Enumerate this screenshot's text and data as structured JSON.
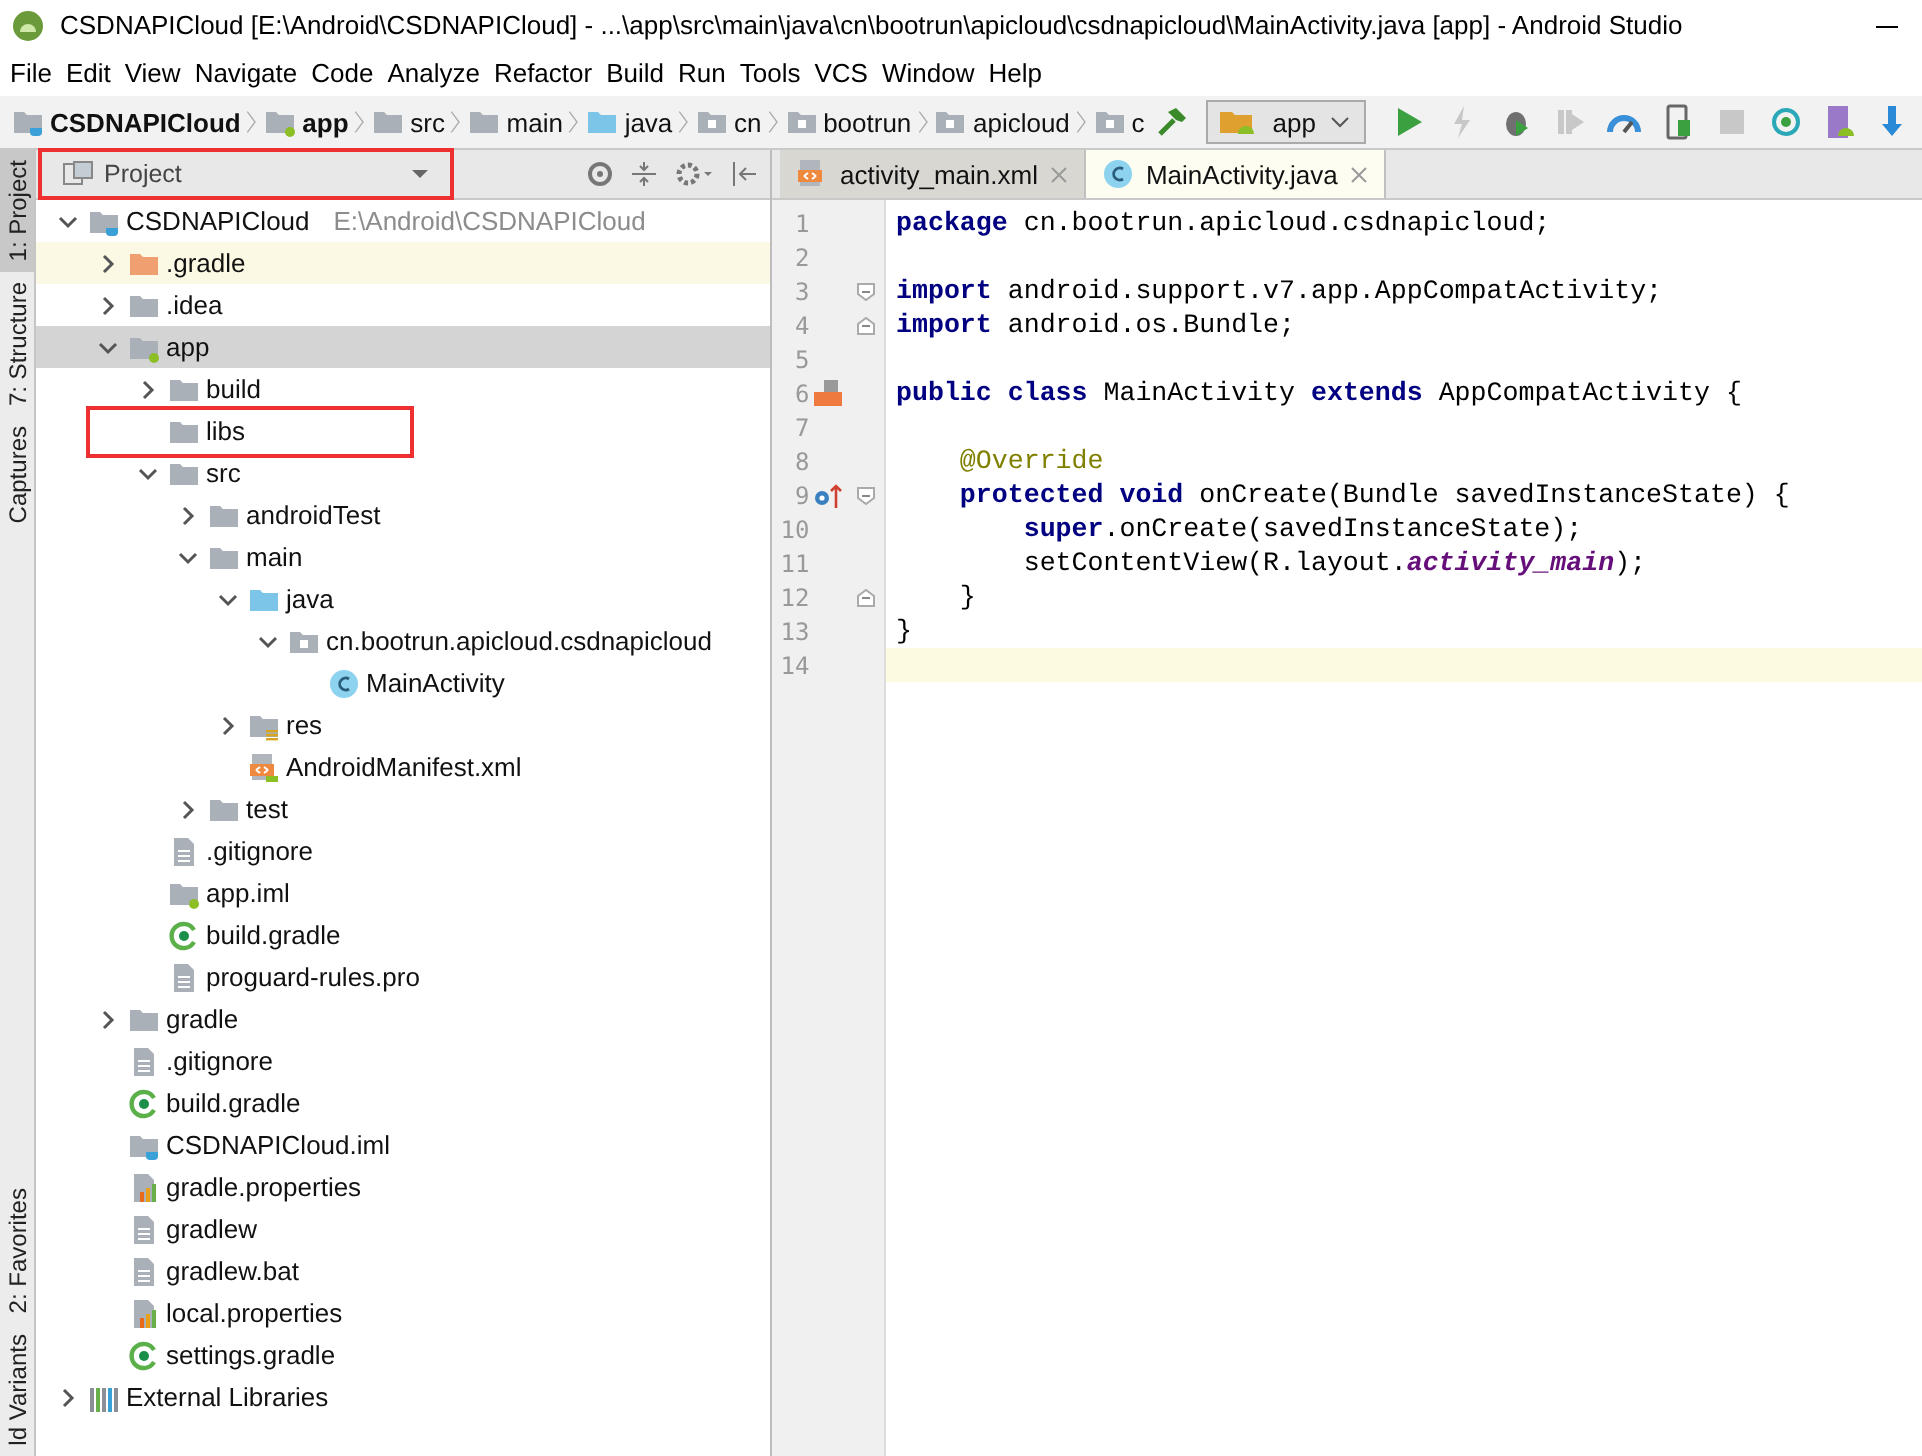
{
  "window": {
    "title": "CSDNAPICloud [E:\\Android\\CSDNAPICloud] - ...\\app\\src\\main\\java\\cn\\bootrun\\apicloud\\csdnapicloud\\MainActivity.java [app] - Android Studio"
  },
  "menu": [
    "File",
    "Edit",
    "View",
    "Navigate",
    "Code",
    "Analyze",
    "Refactor",
    "Build",
    "Run",
    "Tools",
    "VCS",
    "Window",
    "Help"
  ],
  "breadcrumbs": [
    {
      "label": "CSDNAPICloud",
      "kind": "project"
    },
    {
      "label": "app",
      "kind": "module"
    },
    {
      "label": "src",
      "kind": "folder"
    },
    {
      "label": "main",
      "kind": "folder"
    },
    {
      "label": "java",
      "kind": "source"
    },
    {
      "label": "cn",
      "kind": "package"
    },
    {
      "label": "bootrun",
      "kind": "package"
    },
    {
      "label": "apicloud",
      "kind": "package"
    },
    {
      "label": "c",
      "kind": "package"
    }
  ],
  "run_config": {
    "label": "app"
  },
  "tool_tabs_top": [
    {
      "label": "1: Project",
      "selected": true
    },
    {
      "label": "7: Structure",
      "selected": false
    },
    {
      "label": "Captures",
      "selected": false
    }
  ],
  "tool_tabs_bottom": [
    {
      "label": "2: Favorites",
      "selected": false
    },
    {
      "label": "ld Variants",
      "selected": false
    }
  ],
  "project_panel": {
    "view": "Project",
    "highlighted": true
  },
  "tree": [
    {
      "label": "CSDNAPICloud",
      "path": "E:\\Android\\CSDNAPICloud",
      "kind": "project",
      "expanded": true,
      "selected": false,
      "children": [
        {
          "label": ".gradle",
          "kind": "excluded",
          "expanded": false,
          "selected": false,
          "excluded": true
        },
        {
          "label": ".idea",
          "kind": "folder",
          "expanded": false,
          "selected": false
        },
        {
          "label": "app",
          "kind": "module",
          "expanded": true,
          "selected": true,
          "children": [
            {
              "label": "build",
              "kind": "folder",
              "expanded": false,
              "selected": false
            },
            {
              "label": "libs",
              "kind": "folder",
              "selected": false,
              "highlighted": true
            },
            {
              "label": "src",
              "kind": "folder",
              "expanded": true,
              "selected": false,
              "children": [
                {
                  "label": "androidTest",
                  "kind": "folder",
                  "expanded": false,
                  "selected": false
                },
                {
                  "label": "main",
                  "kind": "folder",
                  "expanded": true,
                  "selected": false,
                  "children": [
                    {
                      "label": "java",
                      "kind": "source",
                      "expanded": true,
                      "selected": false,
                      "children": [
                        {
                          "label": "cn.bootrun.apicloud.csdnapicloud",
                          "kind": "package",
                          "expanded": true,
                          "selected": false,
                          "children": [
                            {
                              "label": "MainActivity",
                              "kind": "class",
                              "selected": false
                            }
                          ]
                        }
                      ]
                    },
                    {
                      "label": "res",
                      "kind": "res",
                      "expanded": false,
                      "selected": false
                    },
                    {
                      "label": "AndroidManifest.xml",
                      "kind": "manifest",
                      "selected": false
                    }
                  ]
                },
                {
                  "label": "test",
                  "kind": "folder",
                  "expanded": false,
                  "selected": false
                }
              ]
            },
            {
              "label": ".gitignore",
              "kind": "text",
              "selected": false
            },
            {
              "label": "app.iml",
              "kind": "iml",
              "selected": false
            },
            {
              "label": "build.gradle",
              "kind": "gradle",
              "selected": false
            },
            {
              "label": "proguard-rules.pro",
              "kind": "text",
              "selected": false
            }
          ]
        },
        {
          "label": "gradle",
          "kind": "folder",
          "expanded": false,
          "selected": false
        },
        {
          "label": ".gitignore",
          "kind": "text",
          "selected": false
        },
        {
          "label": "build.gradle",
          "kind": "gradle",
          "selected": false
        },
        {
          "label": "CSDNAPICloud.iml",
          "kind": "project",
          "selected": false
        },
        {
          "label": "gradle.properties",
          "kind": "properties",
          "selected": false
        },
        {
          "label": "gradlew",
          "kind": "text",
          "selected": false
        },
        {
          "label": "gradlew.bat",
          "kind": "text",
          "selected": false
        },
        {
          "label": "local.properties",
          "kind": "properties",
          "selected": false
        },
        {
          "label": "settings.gradle",
          "kind": "gradle",
          "selected": false
        }
      ]
    },
    {
      "label": "External Libraries",
      "kind": "libraries",
      "expanded": false,
      "selected": false
    }
  ],
  "editor_tabs": [
    {
      "label": "activity_main.xml",
      "kind": "layout",
      "selected": false
    },
    {
      "label": "MainActivity.java",
      "kind": "class",
      "selected": true
    }
  ],
  "code": [
    {
      "number": "1",
      "current": false,
      "tokens": [
        {
          "kind": "keyword",
          "text": "package"
        },
        {
          "kind": "plain",
          "text": " cn.bootrun.apicloud.csdnapicloud;"
        }
      ]
    },
    {
      "number": "2",
      "current": false
    },
    {
      "number": "3",
      "current": false,
      "gutter": [
        {
          "kind": "fold_start"
        }
      ],
      "tokens": [
        {
          "kind": "keyword",
          "text": "import"
        },
        {
          "kind": "plain",
          "text": " android.support.v7.app.AppCompatActivity;"
        }
      ]
    },
    {
      "number": "4",
      "current": false,
      "gutter": [
        {
          "kind": "fold_end"
        }
      ],
      "tokens": [
        {
          "kind": "keyword",
          "text": "import"
        },
        {
          "kind": "plain",
          "text": " android.os.Bundle;"
        }
      ]
    },
    {
      "number": "5",
      "current": false
    },
    {
      "number": "6",
      "current": false,
      "gutter": [
        {
          "kind": "layout"
        }
      ],
      "tokens": [
        {
          "kind": "keyword",
          "text": "public class"
        },
        {
          "kind": "plain",
          "text": " MainActivity "
        },
        {
          "kind": "keyword",
          "text": "extends"
        },
        {
          "kind": "plain",
          "text": " AppCompatActivity {"
        }
      ]
    },
    {
      "number": "7",
      "current": false
    },
    {
      "number": "8",
      "current": false,
      "tokens": [
        {
          "kind": "annotation",
          "text": "    @Override"
        }
      ]
    },
    {
      "number": "9",
      "current": false,
      "gutter": [
        {
          "kind": "override"
        },
        {
          "kind": "fold_start"
        }
      ],
      "tokens": [
        {
          "kind": "keyword",
          "text": "    protected void"
        },
        {
          "kind": "plain",
          "text": " onCreate(Bundle savedInstanceState) {"
        }
      ]
    },
    {
      "number": "10",
      "current": false,
      "tokens": [
        {
          "kind": "keyword",
          "text": "        super"
        },
        {
          "kind": "plain",
          "text": ".onCreate(savedInstanceState);"
        }
      ]
    },
    {
      "number": "11",
      "current": false,
      "tokens": [
        {
          "kind": "plain",
          "text": "        setContentView(R.layout."
        },
        {
          "kind": "field",
          "text": "activity_main"
        },
        {
          "kind": "plain",
          "text": ");"
        }
      ]
    },
    {
      "number": "12",
      "current": false,
      "gutter": [
        {
          "kind": "fold_end"
        }
      ],
      "tokens": [
        {
          "kind": "plain",
          "text": "    }"
        }
      ]
    },
    {
      "number": "13",
      "current": false,
      "tokens": [
        {
          "kind": "plain",
          "text": "}"
        }
      ]
    },
    {
      "number": "14",
      "current": true
    }
  ]
}
